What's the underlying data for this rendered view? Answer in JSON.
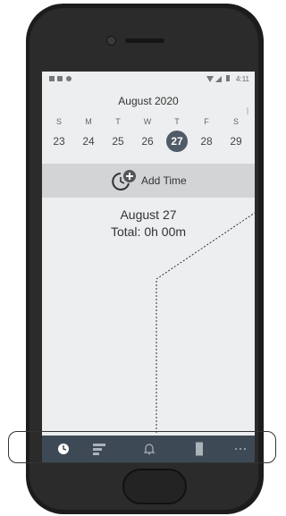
{
  "status_bar": {
    "time": "4:11"
  },
  "calendar": {
    "month_title": "August 2020",
    "weekdays": [
      "S",
      "M",
      "T",
      "W",
      "T",
      "F",
      "S"
    ],
    "days": [
      "23",
      "24",
      "25",
      "26",
      "27",
      "28",
      "29"
    ],
    "selected_day": "27"
  },
  "add_time": {
    "label": "Add Time"
  },
  "summary": {
    "date": "August 27",
    "total": "Total: 0h 00m"
  },
  "tabs": [
    {
      "icon": "clock-icon"
    },
    {
      "icon": "list-bars-icon"
    },
    {
      "icon": "bell-icon"
    },
    {
      "icon": "bookmark-icon"
    },
    {
      "icon": "more-icon"
    }
  ],
  "colors": {
    "selected_day": "#4f5b66",
    "nav_bar": "#3d4a56",
    "screen_bg": "#eceeef",
    "add_bar": "#d2d4d6"
  }
}
